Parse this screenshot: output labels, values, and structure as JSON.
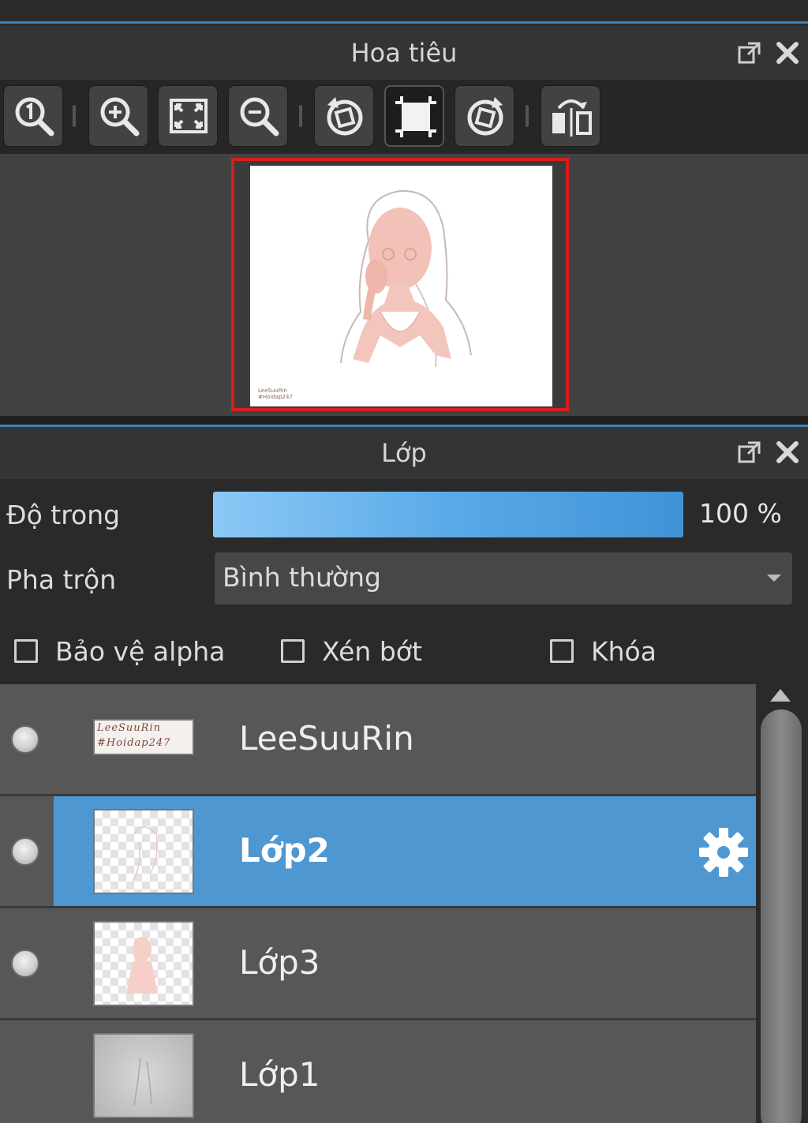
{
  "navigator": {
    "title": "Hoa tiêu",
    "toolbar": [
      {
        "name": "zoom-actual-size",
        "icon": "zoom-1-icon"
      },
      {
        "name": "zoom-in",
        "icon": "zoom-in-icon"
      },
      {
        "name": "fit-to-window",
        "icon": "fit-icon"
      },
      {
        "name": "zoom-out",
        "icon": "zoom-out-icon"
      },
      {
        "name": "rotate-left",
        "icon": "rotate-left-icon"
      },
      {
        "name": "reset-view",
        "icon": "reset-view-icon",
        "active": true
      },
      {
        "name": "rotate-right",
        "icon": "rotate-right-icon"
      },
      {
        "name": "flip-horizontal",
        "icon": "flip-horizontal-icon"
      }
    ],
    "preview_signature": [
      "LeeSuuRin",
      "#Hoidap247"
    ]
  },
  "layer_panel": {
    "title": "Lớp",
    "opacity_label": "Độ trong",
    "opacity_value": "100 %",
    "opacity_fraction": 1.0,
    "blend_label": "Pha trộn",
    "blend_value": "Bình thường",
    "checkboxes": {
      "protect_alpha": "Bảo vệ alpha",
      "clipping": "Xén bớt",
      "lock": "Khóa"
    },
    "layers": [
      {
        "name": "LeeSuuRin",
        "thumb_text": [
          "LeeSuuRin",
          "#Hoidap247"
        ],
        "visible": true,
        "selected": false
      },
      {
        "name": "Lớp2",
        "visible": true,
        "selected": true
      },
      {
        "name": "Lớp3",
        "visible": true,
        "selected": false
      },
      {
        "name": "Lớp1",
        "visible": false,
        "selected": false
      }
    ]
  },
  "colors": {
    "accent": "#4f97d1",
    "frame": "#d41f1f",
    "panel": "#343434"
  }
}
